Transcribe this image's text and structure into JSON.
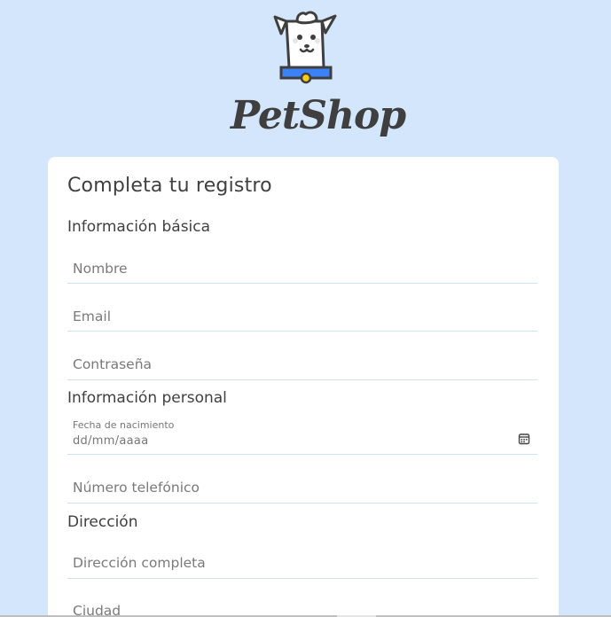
{
  "brand": {
    "name": "PetShop",
    "logo_icon": "dog-mascot-icon"
  },
  "form": {
    "title": "Completa tu registro",
    "sections": {
      "basic": {
        "title": "Información básica",
        "name_placeholder": "Nombre",
        "email_placeholder": "Email",
        "password_placeholder": "Contraseña"
      },
      "personal": {
        "title": "Información personal",
        "birthdate_label": "Fecha de nacimiento",
        "birthdate_placeholder": "dd/mm/aaaa",
        "phone_placeholder": "Número telefónico"
      },
      "address": {
        "title": "Dirección",
        "full_address_placeholder": "Dirección completa",
        "city_placeholder": "Ciudad"
      }
    }
  },
  "colors": {
    "background": "#d3e6fc",
    "card": "#ffffff",
    "field_underline": "#cfe3f3",
    "collar": "#3b82f6",
    "tag": "#facc15"
  }
}
